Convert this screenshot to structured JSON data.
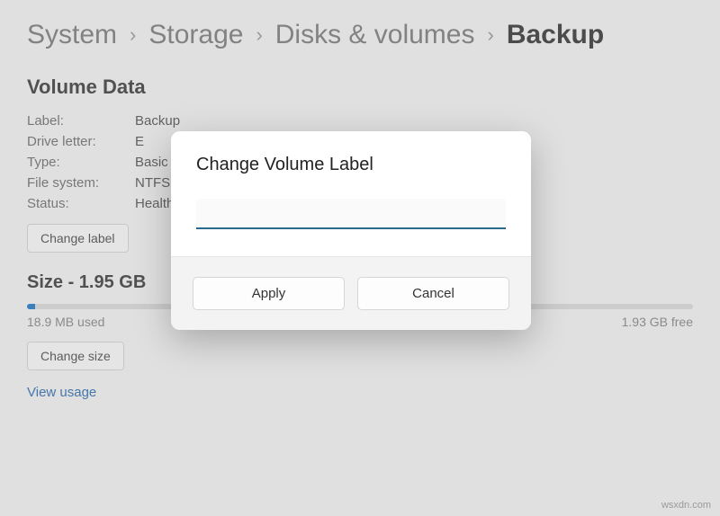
{
  "breadcrumb": {
    "items": [
      "System",
      "Storage",
      "Disks & volumes"
    ],
    "current": "Backup"
  },
  "section": {
    "title": "Volume Data",
    "rows": {
      "label_k": "Label:",
      "label_v": "Backup",
      "drive_k": "Drive letter:",
      "drive_v": "E",
      "type_k": "Type:",
      "type_v": "Basic",
      "fs_k": "File system:",
      "fs_v": "NTFS",
      "status_k": "Status:",
      "status_v": "Healthy"
    },
    "change_label_btn": "Change label"
  },
  "size": {
    "title": "Size - 1.95 GB",
    "used": "18.9 MB used",
    "free": "1.93 GB free",
    "change_size_btn": "Change size",
    "view_usage": "View usage"
  },
  "dialog": {
    "title": "Change Volume Label",
    "input_value": "",
    "apply": "Apply",
    "cancel": "Cancel"
  },
  "watermark": "wsxdn.com"
}
